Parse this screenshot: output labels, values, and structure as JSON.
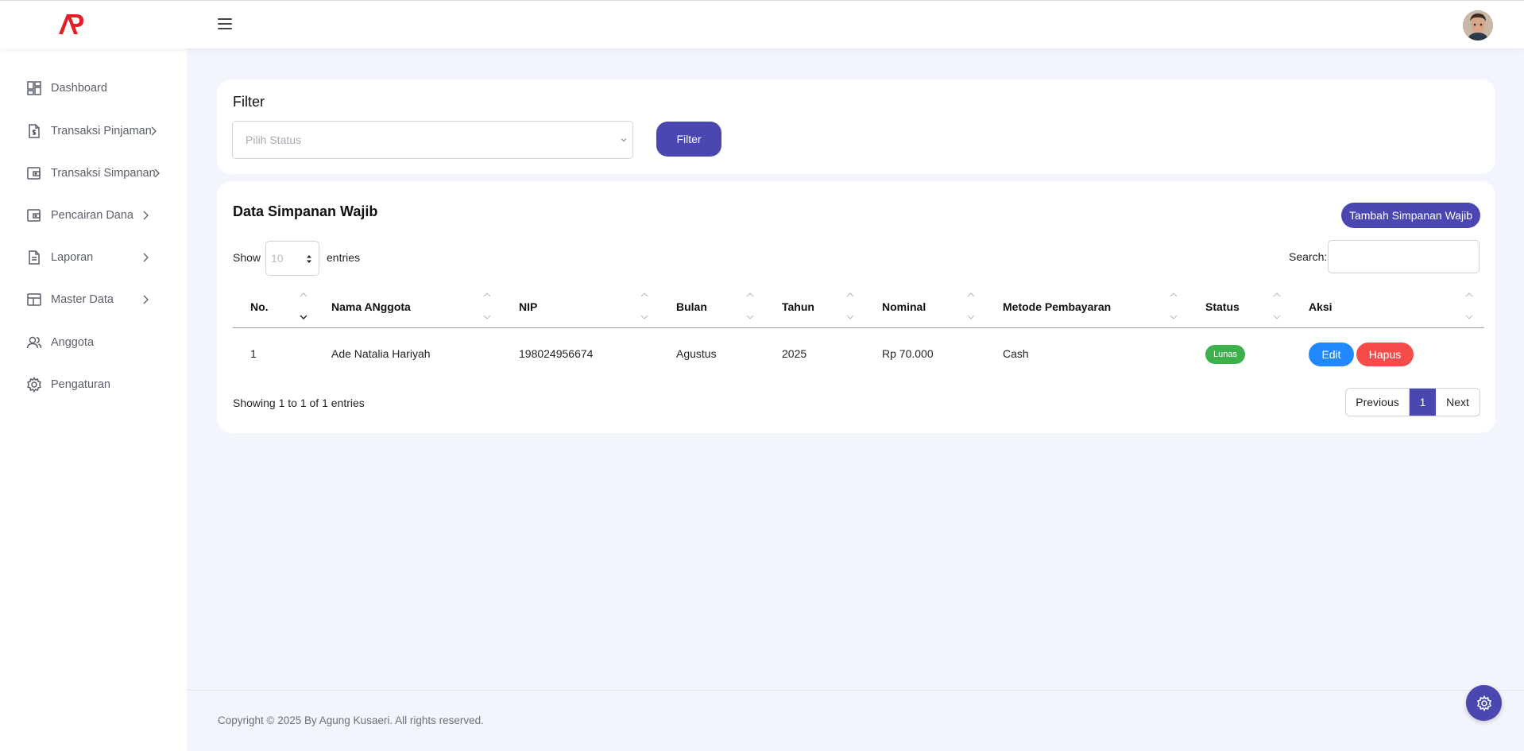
{
  "app": {
    "logo_text": "AP"
  },
  "sidebar": {
    "items": [
      {
        "label": "Dashboard",
        "icon": "dashboard-grid-icon",
        "has_submenu": false
      },
      {
        "label": "Transaksi Pinjaman",
        "icon": "money-document-icon",
        "has_submenu": true
      },
      {
        "label": "Transaksi Simpanan",
        "icon": "wallet-icon",
        "has_submenu": true
      },
      {
        "label": "Pencairan Dana",
        "icon": "wallet-icon",
        "has_submenu": true
      },
      {
        "label": "Laporan",
        "icon": "document-icon",
        "has_submenu": true
      },
      {
        "label": "Master Data",
        "icon": "table-icon",
        "has_submenu": true
      },
      {
        "label": "Anggota",
        "icon": "users-icon",
        "has_submenu": false
      },
      {
        "label": "Pengaturan",
        "icon": "gear-icon",
        "has_submenu": false
      }
    ]
  },
  "filter": {
    "title": "Filter",
    "status_placeholder": "Pilih Status",
    "button_label": "Filter"
  },
  "data": {
    "title": "Data Simpanan Wajib",
    "add_button_label": "Tambah Simpanan Wajib",
    "show_label": "Show",
    "entries_value": "10",
    "entries_label": "entries",
    "search_label": "Search:",
    "search_value": "",
    "columns": [
      "No.",
      "Nama ANggota",
      "NIP",
      "Bulan",
      "Tahun",
      "Nominal",
      "Metode Pembayaran",
      "Status",
      "Aksi"
    ],
    "rows": [
      {
        "no": "1",
        "nama": "Ade Natalia Hariyah",
        "nip": "198024956674",
        "bulan": "Agustus",
        "tahun": "2025",
        "nominal": "Rp 70.000",
        "metode": "Cash",
        "status": "Lunas",
        "edit_label": "Edit",
        "hapus_label": "Hapus"
      }
    ],
    "info": "Showing 1 to 1 of 1 entries",
    "pagination": {
      "previous": "Previous",
      "current": "1",
      "next": "Next"
    }
  },
  "footer": {
    "copyright": "Copyright © 2025 By Agung Kusaeri. All rights reserved."
  },
  "colors": {
    "primary": "#4a48b0",
    "edit": "#2288ff",
    "delete": "#f54b4b",
    "success": "#3cb04b",
    "background": "#f3f5fd",
    "logo": "#e31e24"
  }
}
